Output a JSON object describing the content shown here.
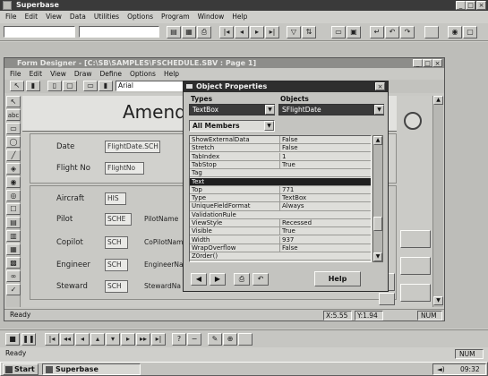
{
  "app": {
    "title": "Superbase",
    "menu": [
      "File",
      "Edit",
      "View",
      "Data",
      "Utilities",
      "Options",
      "Program",
      "Window",
      "Help"
    ],
    "status_text": "Ready",
    "status_num": "NUM"
  },
  "form_window": {
    "title": "Form Designer - [C:\\SB\\SAMPLES\\FSCHEDULE.SBV : Page 1]",
    "menu": [
      "File",
      "Edit",
      "View",
      "Draw",
      "Define",
      "Options",
      "Help"
    ],
    "font_name": "Arial",
    "heading": "Amend",
    "status_text": "Ready",
    "coord_x": "X:5.55",
    "coord_y": "Y:1.94",
    "status_num": "NUM",
    "fields": [
      {
        "label": "Date",
        "value": "FlightDate.SCH"
      },
      {
        "label": "Flight No",
        "value": "FlightNo"
      },
      {
        "label": "Aircraft",
        "value": "HIS"
      },
      {
        "label": "Pilot",
        "value": "SCHE",
        "label2": "PilotName"
      },
      {
        "label": "Copilot",
        "value": "SCH",
        "label2": "CoPilotNam"
      },
      {
        "label": "Engineer",
        "value": "SCH",
        "label2": "EngineerNa"
      },
      {
        "label": "Steward",
        "value": "SCH",
        "label2": "StewardNa"
      }
    ]
  },
  "properties": {
    "title": "Object Properties",
    "types_label": "Types",
    "objects_label": "Objects",
    "type_value": "TextBox",
    "object_value": "SFlightDate",
    "members_value": "All Members",
    "help_label": "Help",
    "rows": [
      {
        "name": "ShowExternalData",
        "value": "False"
      },
      {
        "name": "Stretch",
        "value": "False"
      },
      {
        "name": "TabIndex",
        "value": "1"
      },
      {
        "name": "TabStop",
        "value": "True"
      },
      {
        "name": "Tag",
        "value": ""
      },
      {
        "name": "Text",
        "value": "",
        "selected": true
      },
      {
        "name": "Top",
        "value": "771"
      },
      {
        "name": "Type",
        "value": "TextBox"
      },
      {
        "name": "UniqueFieldFormat",
        "value": "Always"
      },
      {
        "name": "ValidationRule",
        "value": ""
      },
      {
        "name": "ViewStyle",
        "value": "Recessed"
      },
      {
        "name": "Visible",
        "value": "True"
      },
      {
        "name": "Width",
        "value": "937"
      },
      {
        "name": "WrapOverflow",
        "value": "False"
      },
      {
        "name": "Z0rder()",
        "value": ""
      }
    ]
  },
  "taskbar": {
    "start_label": "Start",
    "task_label": "Superbase",
    "clock": "09:32"
  }
}
